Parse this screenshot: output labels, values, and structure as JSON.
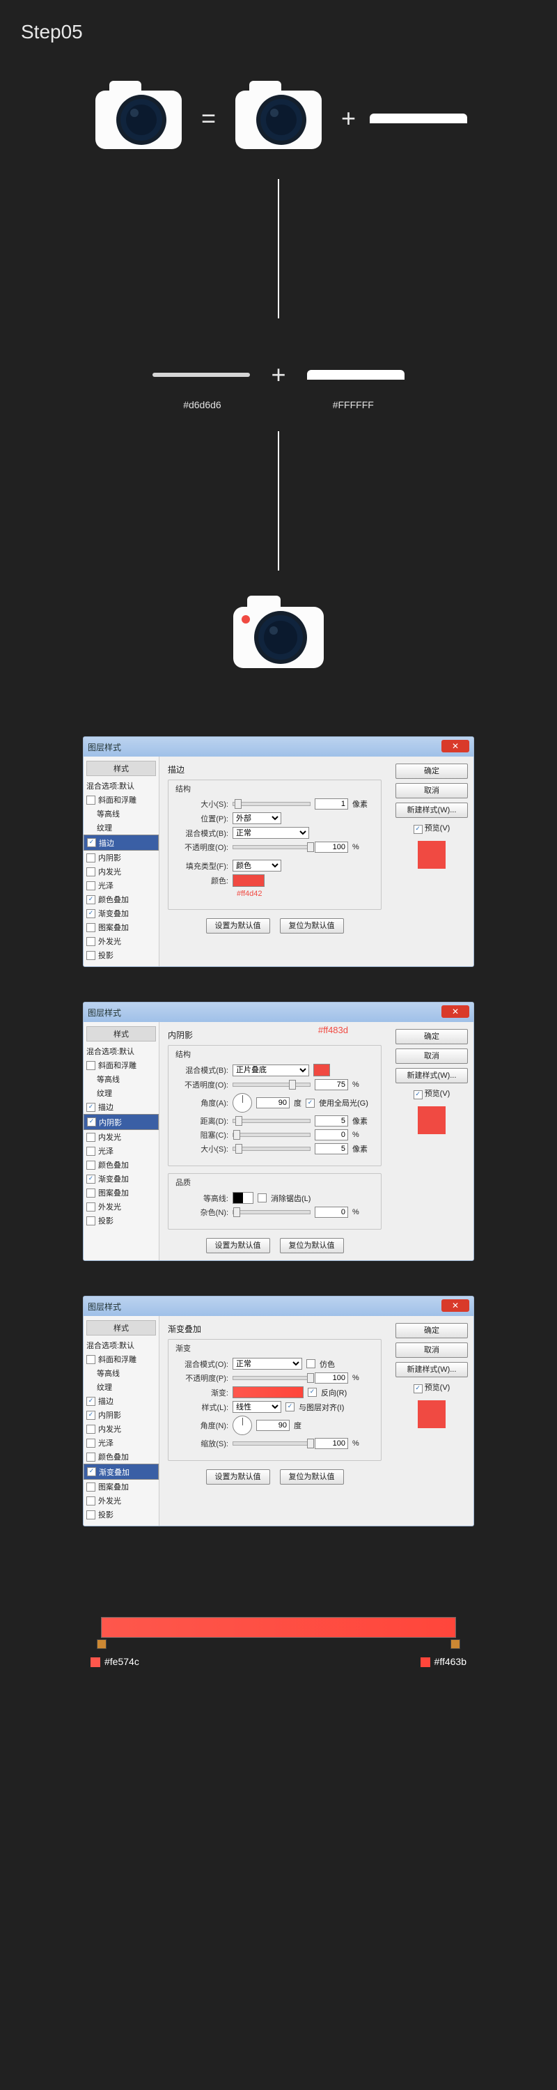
{
  "step_title": "Step05",
  "hero": {
    "equals": "=",
    "plus": "+"
  },
  "row2": {
    "plus": "+",
    "label1": "#d6d6d6",
    "label2": "#FFFFFF"
  },
  "stylelist": {
    "header": "样式",
    "items": [
      {
        "label": "混合选项:默认"
      },
      {
        "label": "斜面和浮雕"
      },
      {
        "label": "等高线"
      },
      {
        "label": "纹理"
      },
      {
        "label": "描边"
      },
      {
        "label": "内阴影"
      },
      {
        "label": "内发光"
      },
      {
        "label": "光泽"
      },
      {
        "label": "颜色叠加"
      },
      {
        "label": "渐变叠加"
      },
      {
        "label": "图案叠加"
      },
      {
        "label": "外发光"
      },
      {
        "label": "投影"
      }
    ]
  },
  "right": {
    "ok": "确定",
    "cancel": "取消",
    "newstyle": "新建样式(W)...",
    "preview": "预览(V)"
  },
  "common": {
    "default_btn": "设置为默认值",
    "reset_btn": "复位为默认值",
    "dialog_title": "图层样式",
    "close": "✕"
  },
  "d1": {
    "panel_title": "描边",
    "sect_struct": "结构",
    "size_label": "大小(S):",
    "size_val": "1",
    "size_unit": "像素",
    "pos_label": "位置(P):",
    "pos_val": "外部",
    "blend_label": "混合模式(B):",
    "blend_val": "正常",
    "opacity_label": "不透明度(O):",
    "opacity_val": "100",
    "opacity_unit": "%",
    "filltype_label": "填充类型(F):",
    "filltype_val": "颜色",
    "color_label": "颜色:",
    "colornote": "#ff4d42",
    "selected": "描边",
    "checked": [
      "描边",
      "颜色叠加",
      "渐变叠加"
    ]
  },
  "d2": {
    "panel_title": "内阴影",
    "sect_struct": "结构",
    "sect_quality": "品质",
    "blend_label": "混合模式(B):",
    "blend_val": "正片叠底",
    "annot": "#ff483d",
    "opacity_label": "不透明度(O):",
    "opacity_val": "75",
    "opacity_unit": "%",
    "angle_label": "角度(A):",
    "angle_val": "90",
    "angle_unit": "度",
    "use_global": "使用全局光(G)",
    "dist_label": "距离(D):",
    "dist_val": "5",
    "dist_unit": "像素",
    "choke_label": "阻塞(C):",
    "choke_val": "0",
    "choke_unit": "%",
    "sizeb_label": "大小(S):",
    "sizeb_val": "5",
    "sizeb_unit": "像素",
    "contour_label": "等高线:",
    "antialias": "消除锯齿(L)",
    "noise_label": "杂色(N):",
    "noise_val": "0",
    "noise_unit": "%",
    "selected": "内阴影",
    "checked": [
      "描边",
      "内阴影",
      "渐变叠加"
    ]
  },
  "d3": {
    "panel_title": "渐变叠加",
    "sect_grad": "渐变",
    "blend_label": "混合模式(O):",
    "blend_val": "正常",
    "dither": "仿色",
    "opacity_label": "不透明度(P):",
    "opacity_val": "100",
    "opacity_unit": "%",
    "grad_label": "渐变:",
    "reverse": "反向(R)",
    "style_label": "样式(L):",
    "style_val": "线性",
    "align": "与图层对齐(I)",
    "angle_label": "角度(N):",
    "angle_val": "90",
    "angle_unit": "度",
    "scale_label": "缩放(S):",
    "scale_val": "100",
    "scale_unit": "%",
    "selected": "渐变叠加",
    "checked": [
      "描边",
      "内阴影",
      "渐变叠加"
    ]
  },
  "grad": {
    "left": "#fe574c",
    "right": "#ff463b"
  }
}
